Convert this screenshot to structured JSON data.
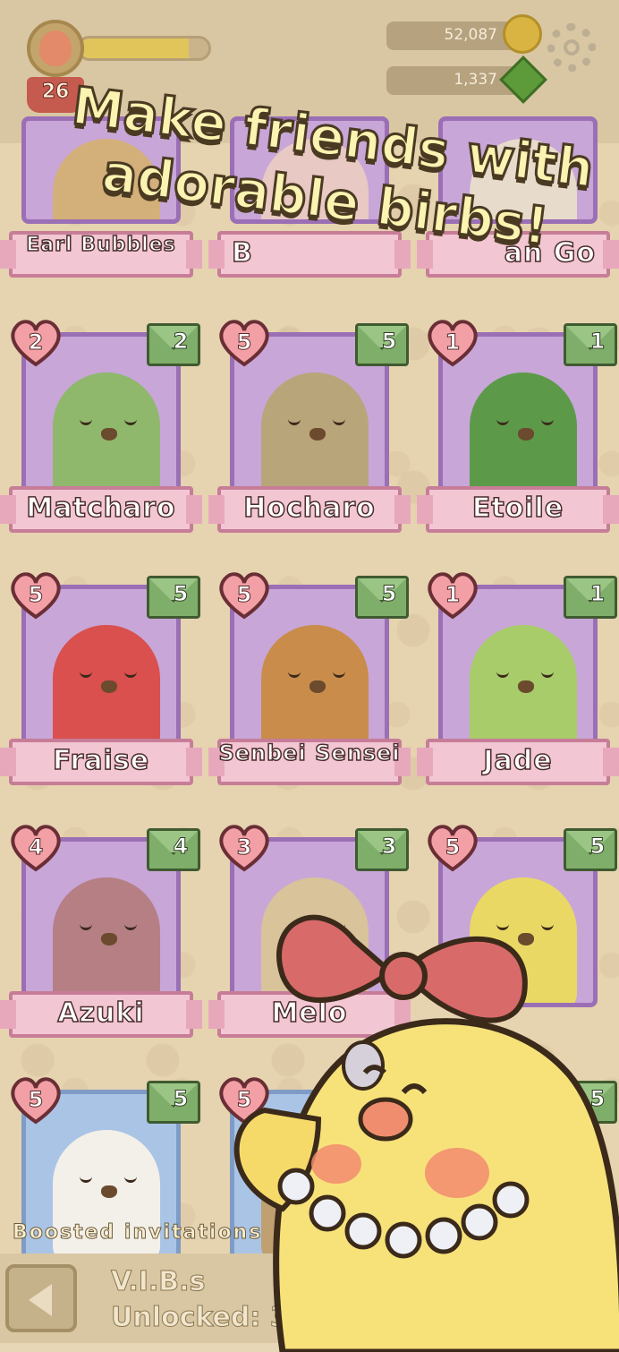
{
  "header": {
    "level": "26",
    "xp_progress": 0.85,
    "coins": "52,087",
    "gems": "1,337"
  },
  "headline": {
    "line1": "Make friends with",
    "line2": "adorable birbs!"
  },
  "partial_cards": {
    "left": "Earl Bubbles",
    "middle": "B",
    "right": "an Go"
  },
  "cards": [
    {
      "name": "Matcharo",
      "hearts": "2",
      "letters": "2",
      "color": "#8fb86c"
    },
    {
      "name": "Hocharo",
      "hearts": "5",
      "letters": "5",
      "color": "#b9a57a"
    },
    {
      "name": "Etoile",
      "hearts": "1",
      "letters": "1",
      "color": "#5c9a4a"
    },
    {
      "name": "Fraise",
      "hearts": "5",
      "letters": "5",
      "color": "#d9504e"
    },
    {
      "name": "Senbei Sensei",
      "hearts": "5",
      "letters": "5",
      "color": "#c98c4a"
    },
    {
      "name": "Jade",
      "hearts": "1",
      "letters": "1",
      "color": "#a8cc6a"
    },
    {
      "name": "Azuki",
      "hearts": "4",
      "letters": "4",
      "color": "#b57f84"
    },
    {
      "name": "Melo",
      "hearts": "3",
      "letters": "3",
      "color": "#d8c39a"
    },
    {
      "name": "",
      "hearts": "5",
      "letters": "5",
      "color": "#e9d964"
    },
    {
      "name": "",
      "hearts": "5",
      "letters": "5",
      "color": "#f3efe9"
    },
    {
      "name": "",
      "hearts": "5",
      "letters": "",
      "color": "#c0a070"
    },
    {
      "name": "",
      "hearts": "",
      "letters": "5",
      "color": "#e9d964"
    }
  ],
  "footer": {
    "boosted": "Boosted invitations",
    "vibs_line1": "V.I.B.s",
    "vibs_line2": "Unlocked: 3"
  }
}
